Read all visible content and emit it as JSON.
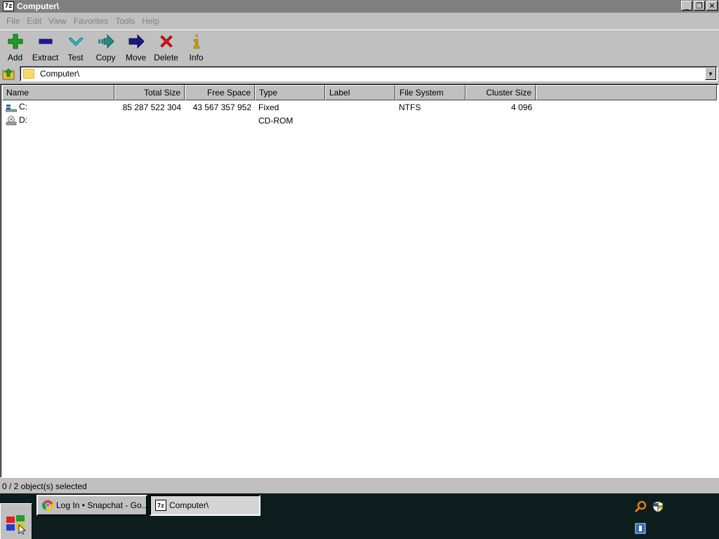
{
  "window": {
    "title": "Computer\\",
    "app_icon_text": "7z",
    "buttons": {
      "minimize": "_",
      "restore": "❐",
      "close": "✕"
    }
  },
  "menu": [
    {
      "label": "File"
    },
    {
      "label": "Edit"
    },
    {
      "label": "View"
    },
    {
      "label": "Favorites"
    },
    {
      "label": "Tools"
    },
    {
      "label": "Help"
    }
  ],
  "toolbar": [
    {
      "label": "Add",
      "icon": "plus-icon",
      "color": "#1aa01a"
    },
    {
      "label": "Extract",
      "icon": "minus-icon",
      "color": "#1a1a9a"
    },
    {
      "label": "Test",
      "icon": "check-icon",
      "color": "#30c0d0"
    },
    {
      "label": "Copy",
      "icon": "copy-arrow-icon",
      "color": "#2a8a80"
    },
    {
      "label": "Move",
      "icon": "move-arrow-icon",
      "color": "#1a1a80"
    },
    {
      "label": "Delete",
      "icon": "delete-x-icon",
      "color": "#e01a1a"
    },
    {
      "label": "Info",
      "icon": "info-icon",
      "color": "#c0a000"
    }
  ],
  "address": {
    "path": "Computer\\"
  },
  "columns": [
    "Name",
    "Total Size",
    "Free Space",
    "Type",
    "Label",
    "File System",
    "Cluster Size"
  ],
  "rows": [
    {
      "name": "C:",
      "total_size": "85 287 522 304",
      "free_space": "43 567 357 952",
      "type": "Fixed",
      "label": "",
      "file_system": "NTFS",
      "cluster_size": "4 096",
      "icon": "hard-drive-icon"
    },
    {
      "name": "D:",
      "total_size": "",
      "free_space": "",
      "type": "CD-ROM",
      "label": "",
      "file_system": "",
      "cluster_size": "",
      "icon": "cdrom-drive-icon"
    }
  ],
  "status": {
    "text": "0 / 2 object(s) selected"
  },
  "taskbar": {
    "tasks": [
      {
        "label": "Log In • Snapchat - Go...",
        "icon": "chrome-icon"
      },
      {
        "label": "Computer\\",
        "icon": "7zip-icon",
        "active": true
      }
    ]
  }
}
